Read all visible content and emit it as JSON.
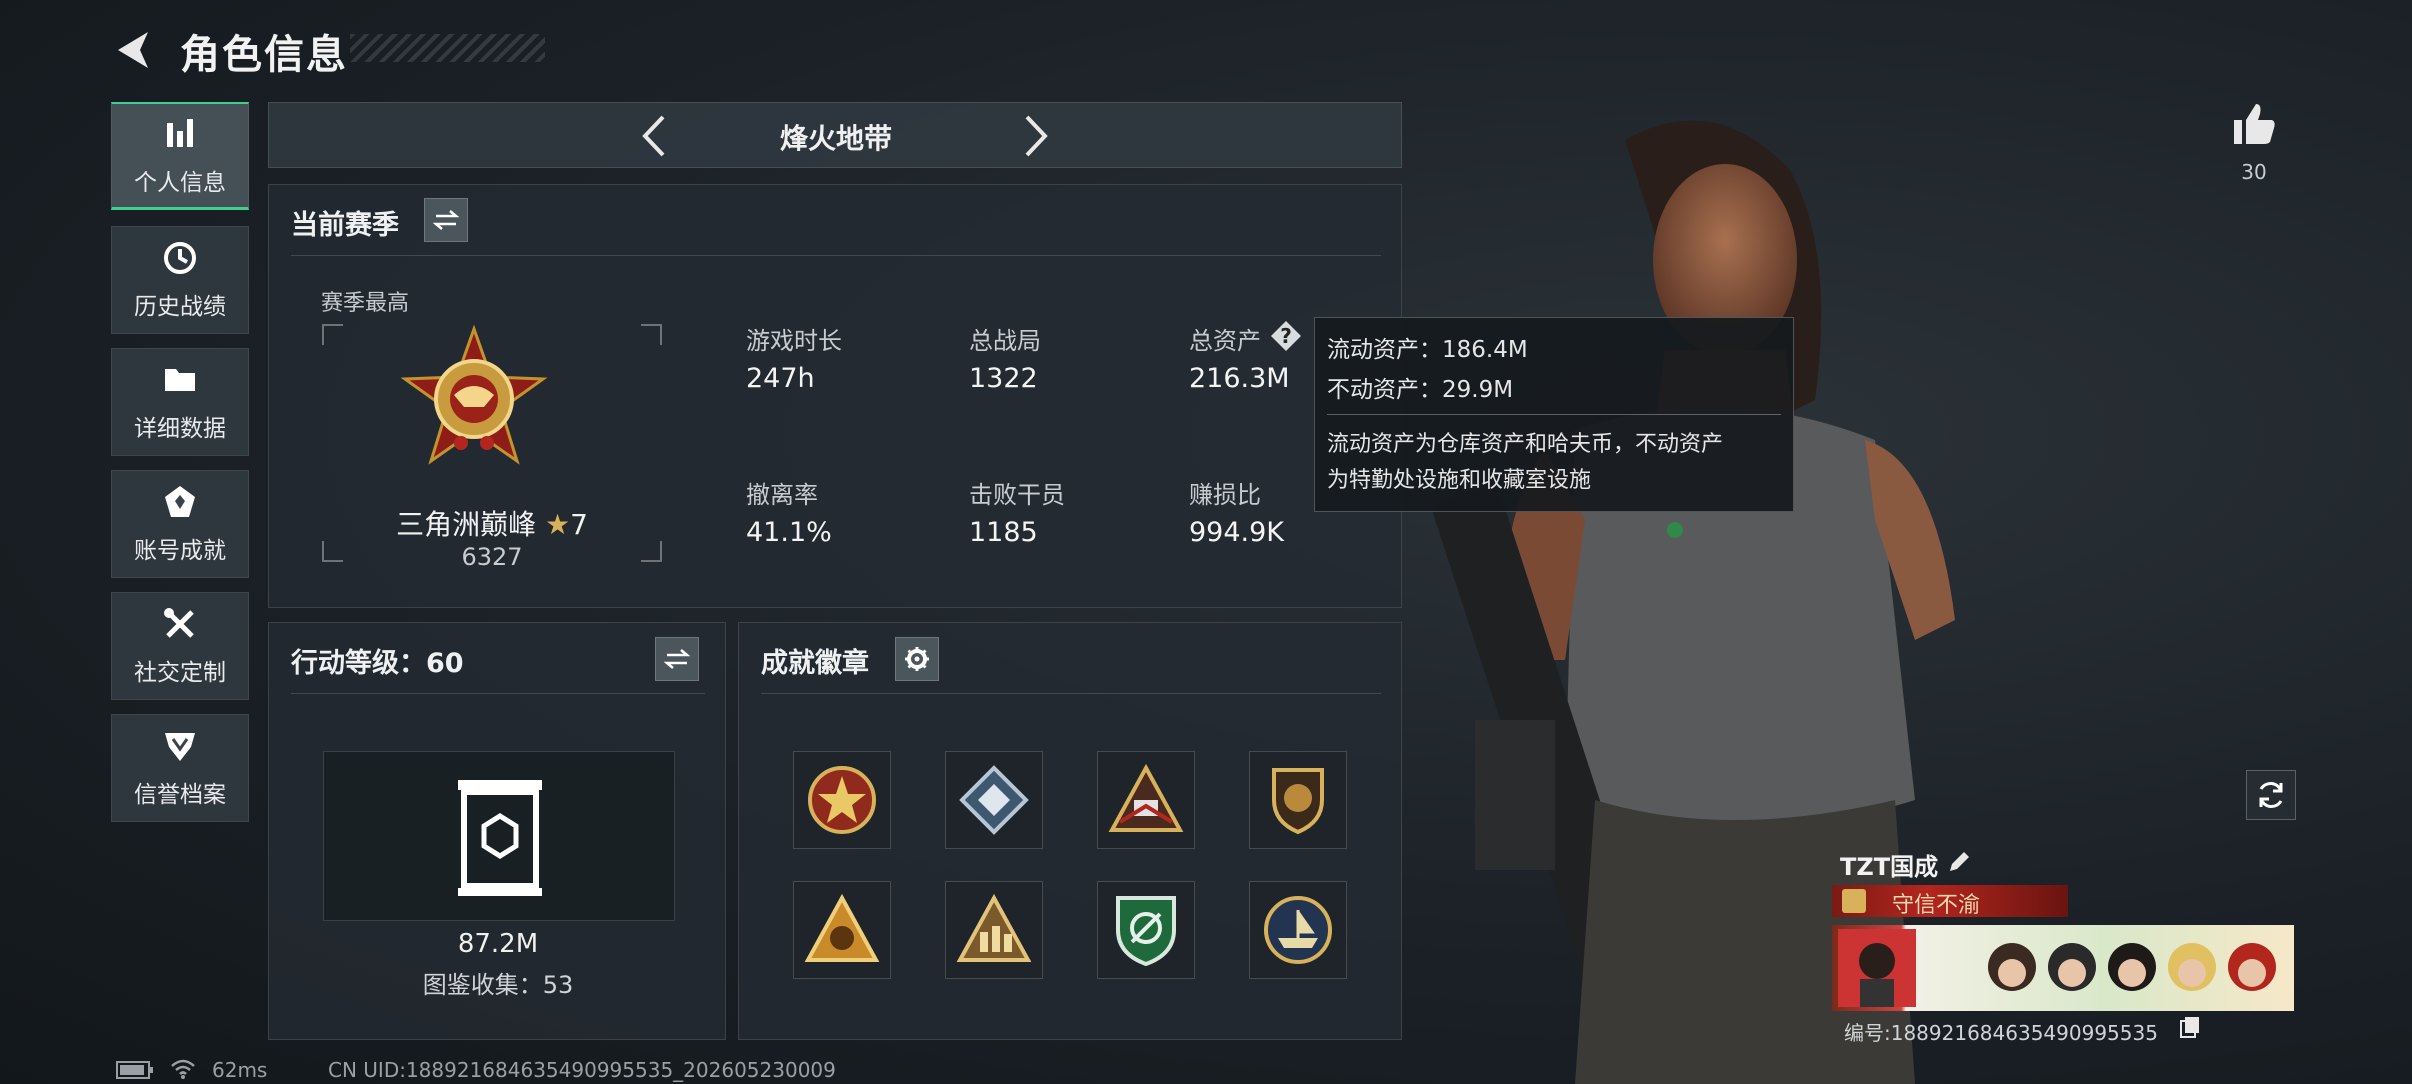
{
  "header": {
    "title": "角色信息"
  },
  "sidebar": {
    "items": [
      {
        "label": "个人信息",
        "icon": "bar-chart-icon",
        "active": true
      },
      {
        "label": "历史战绩",
        "icon": "clock-icon"
      },
      {
        "label": "详细数据",
        "icon": "folder-icon"
      },
      {
        "label": "账号成就",
        "icon": "achievement-icon"
      },
      {
        "label": "社交定制",
        "icon": "tools-icon"
      },
      {
        "label": "信誉档案",
        "icon": "shield-badge-icon"
      }
    ]
  },
  "mode": {
    "title": "烽火地带"
  },
  "season": {
    "title": "当前赛季",
    "best_label": "赛季最高",
    "rank_name": "三角洲巅峰",
    "rank_stars": "7",
    "rank_score": "6327",
    "stats": [
      {
        "label": "游戏时长",
        "value": "247h"
      },
      {
        "label": "总战局",
        "value": "1322"
      },
      {
        "label": "总资产",
        "value": "216.3M"
      },
      {
        "label": "撤离率",
        "value": "41.1%"
      },
      {
        "label": "击败干员",
        "value": "1185"
      },
      {
        "label": "赚损比",
        "value": "994.9K"
      }
    ]
  },
  "tooltip": {
    "liquid": "流动资产：186.4M",
    "fixed": "不动资产：29.9M",
    "note_line1": "流动资产为仓库资产和哈夫币，不动资产",
    "note_line2": "为特勤处设施和收藏室设施"
  },
  "action_level": {
    "title": "行动等级：60",
    "value": "87.2M",
    "collection": "图鉴收集：53"
  },
  "achievements": {
    "title": "成就徽章",
    "badges": [
      "star-badge-icon",
      "diamond-badge-icon",
      "triangle-badge-icon",
      "shield-lion-icon",
      "triangle-gold-icon",
      "triangle-squad-icon",
      "green-shield-icon",
      "ship-badge-icon"
    ]
  },
  "likes": {
    "count": "30"
  },
  "player": {
    "name": "TZT国成",
    "title": "守信不渝",
    "id": "编号:188921684635490995535"
  },
  "status_bar": {
    "ping": "62ms",
    "uid": "CN UID:188921684635490995535_202605230009"
  },
  "colors": {
    "accent": "#3ed08c",
    "gold": "#d8b25a",
    "title_red": "#b3261e"
  }
}
